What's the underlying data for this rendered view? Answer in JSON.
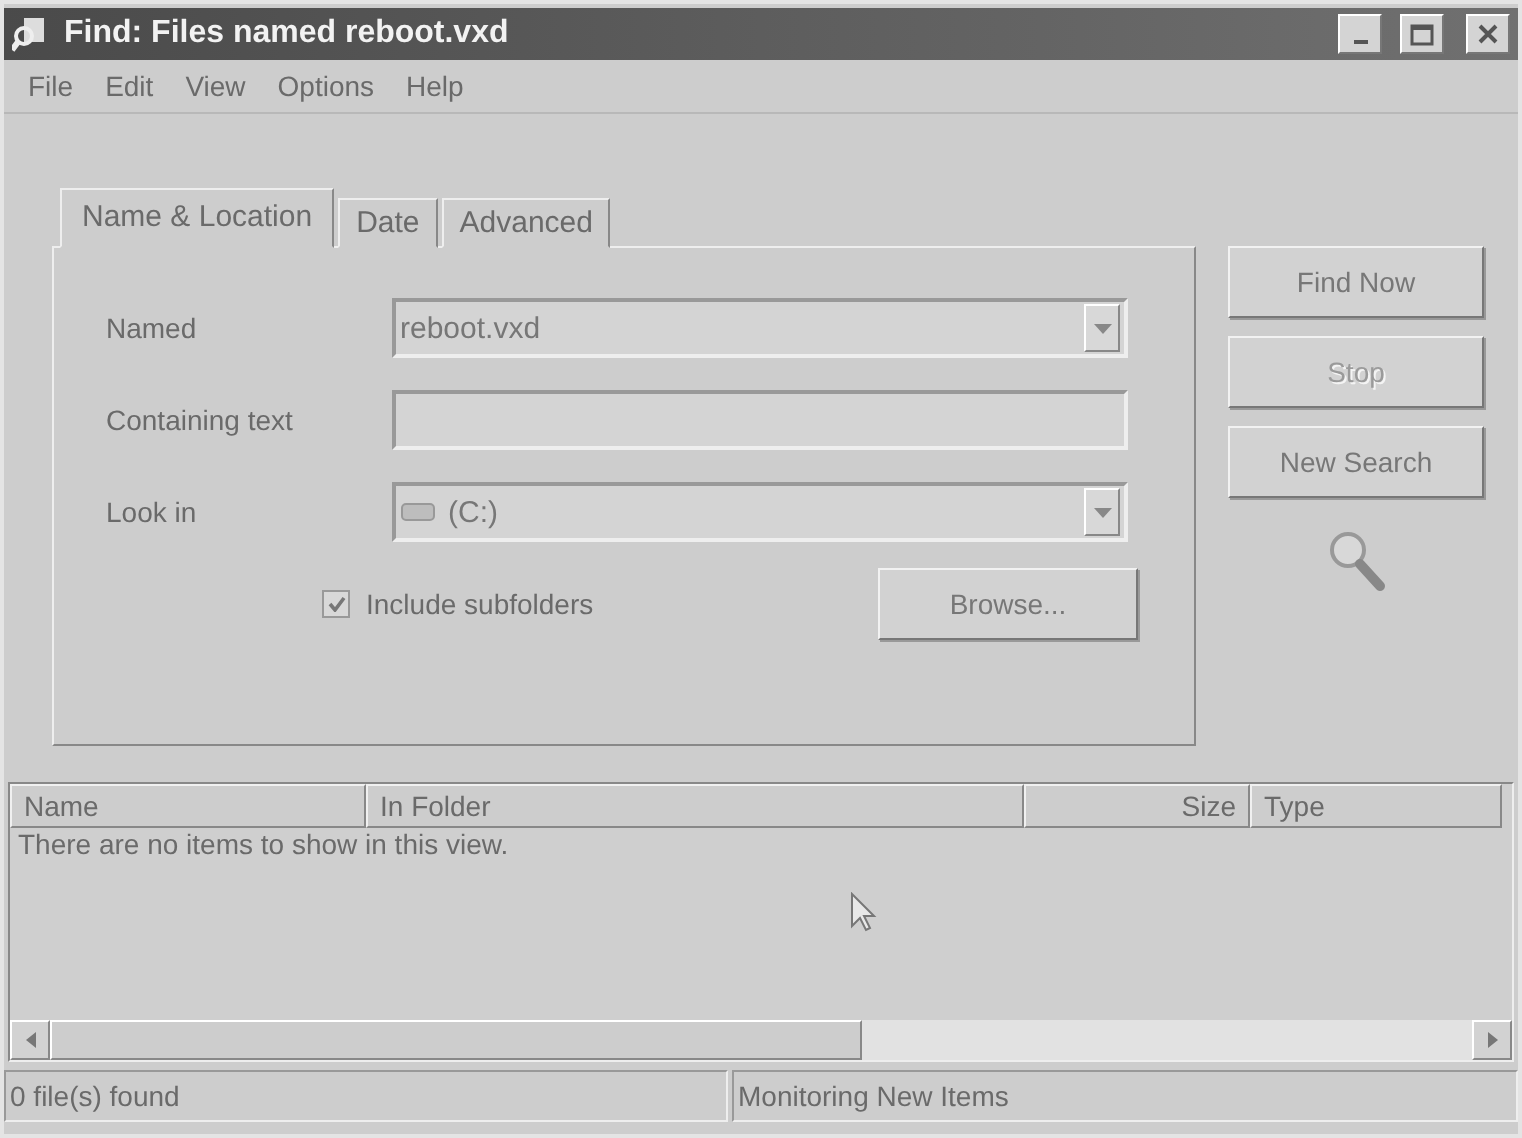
{
  "window": {
    "title": "Find: Files named reboot.vxd"
  },
  "menu": [
    "File",
    "Edit",
    "View",
    "Options",
    "Help"
  ],
  "tabs": [
    {
      "label": "Name & Location",
      "selected": true
    },
    {
      "label": "Date",
      "selected": false
    },
    {
      "label": "Advanced",
      "selected": false
    }
  ],
  "fields": [
    {
      "label": "Named",
      "kind": "combo",
      "value": "reboot.vxd"
    },
    {
      "label": "Containing text",
      "kind": "text"
    },
    {
      "label": "Look in",
      "kind": "drive",
      "value": "(C:)"
    }
  ],
  "include_subfolders": {
    "label": "Include subfolders",
    "checked": true
  },
  "browse_button": "Browse...",
  "actions": [
    {
      "label": "Find Now",
      "disabled": false
    },
    {
      "label": "Stop",
      "disabled": true
    },
    {
      "label": "New Search",
      "disabled": false
    }
  ],
  "results": {
    "columns": [
      {
        "label": "Name",
        "kind": "text"
      },
      {
        "label": "In Folder",
        "kind": "text"
      },
      {
        "label": "Size",
        "kind": "number"
      },
      {
        "label": "Type",
        "kind": "text"
      }
    ],
    "empty_message": "There are no items to show in this view."
  },
  "status_bar": [
    "0 file(s) found",
    "Monitoring New Items"
  ]
}
